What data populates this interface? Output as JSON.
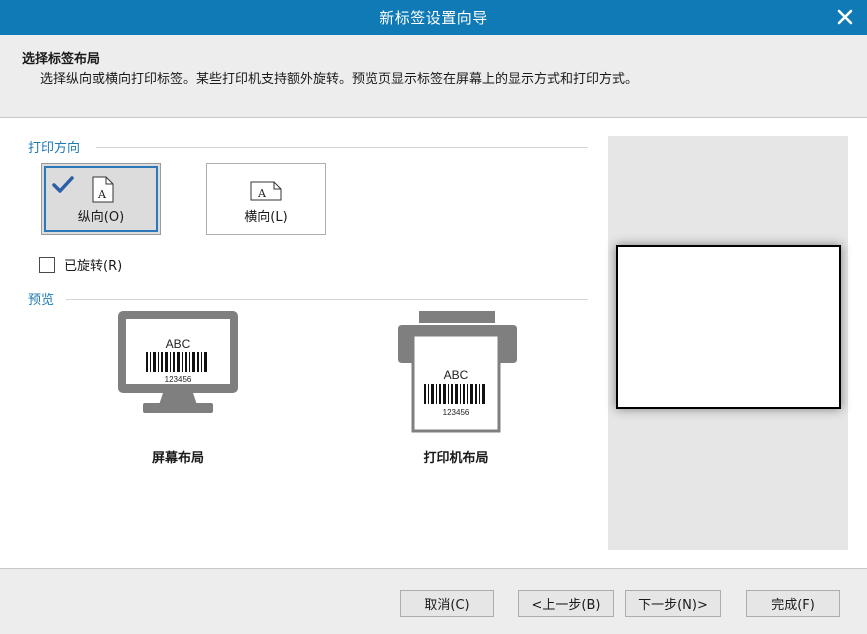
{
  "window": {
    "title": "新标签设置向导"
  },
  "header": {
    "title": "选择标签布局",
    "description": "选择纵向或横向打印标签。某些打印机支持额外旋转。预览页显示标签在屏幕上的显示方式和打印方式。"
  },
  "orientation": {
    "section_label": "打印方向",
    "portrait_label": "纵向(O)",
    "landscape_label": "横向(L)",
    "selected": "portrait",
    "page_letter": "A"
  },
  "rotated": {
    "label": "已旋转(R)",
    "checked": false
  },
  "preview": {
    "section_label": "预览",
    "screen_caption": "屏幕布局",
    "printer_caption": "打印机布局",
    "sample_text": "ABC",
    "sample_number": "123456"
  },
  "buttons": {
    "cancel": "取消(C)",
    "back": "<上一步(B)",
    "next": "下一步(N)>",
    "finish": "完成(F)"
  },
  "colors": {
    "titlebar": "#0f7ab5",
    "accent": "#1e7bb4",
    "icon_gray": "#7f7f7f"
  }
}
